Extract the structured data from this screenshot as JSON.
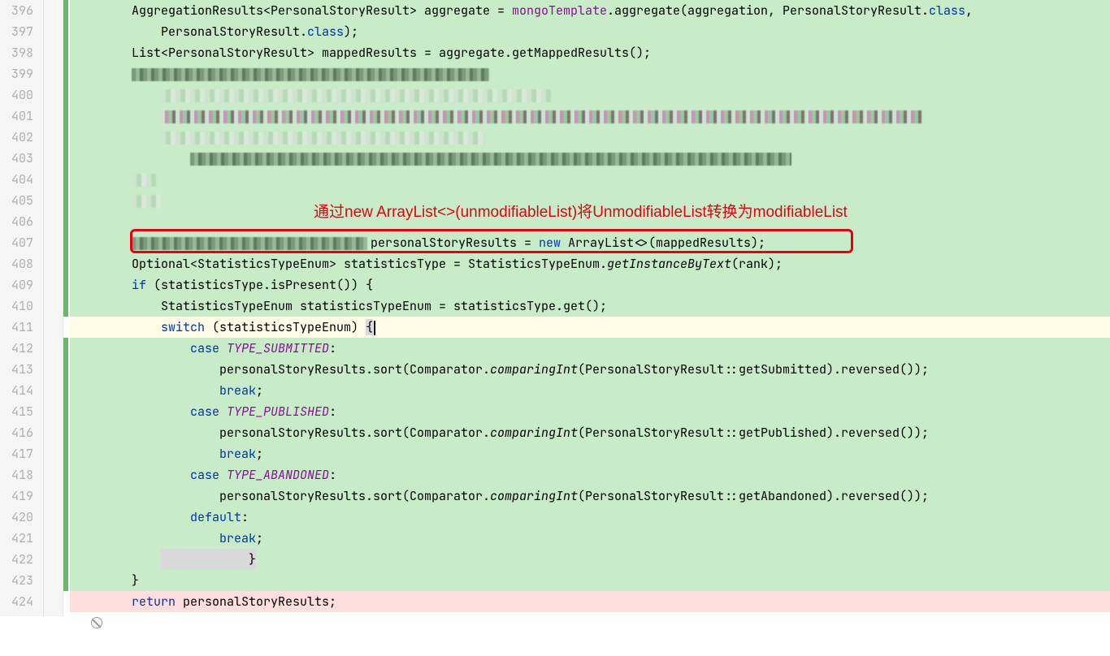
{
  "annotation": "通过new ArrayList<>(unmodifiableList)将UnmodifiableList转换为modifiableList",
  "lines": {
    "start": 396,
    "end": 424
  },
  "code": {
    "l396": {
      "pre": "        AggregationResults<PersonalStoryResult> aggregate = ",
      "mongo": "mongoTemplate",
      "post": ".aggregate(aggregation, PersonalStoryResult.",
      "clsref": "class",
      "tail": ","
    },
    "l397": {
      "pre": "            PersonalStoryResult.",
      "clsref": "class",
      "tail": ");"
    },
    "l398": "        List<PersonalStoryResult> mappedResults = aggregate.getMappedResults();",
    "l407": {
      "mid": "                personalStoryResults = ",
      "newkw": "new",
      "after": " ArrayList<>(mappedResults);"
    },
    "l408": {
      "pre": "        Optional<StatisticsTypeEnum> statisticsType = StatisticsTypeEnum.",
      "getinst": "getInstanceByText",
      "tail": "(rank);"
    },
    "l409": {
      "ifkw": "if",
      "rest": " (statisticsType.isPresent()) {"
    },
    "l410": "            StatisticsTypeEnum statisticsTypeEnum = statisticsType.get();",
    "l411": {
      "sw": "switch",
      "mid": " (statisticsTypeEnum) ",
      "brace": "{"
    },
    "l412": {
      "casekw": "case",
      "sp": " ",
      "enum": "TYPE_SUBMITTED",
      "tail": ":"
    },
    "l413": {
      "pre": "                    personalStoryResults.sort(Comparator.",
      "ci": "comparingInt",
      "mid": "(PersonalStoryResult::getSubmitted).reversed());"
    },
    "l414": {
      "br": "break",
      "tail": ";"
    },
    "l415": {
      "casekw": "case",
      "sp": " ",
      "enum": "TYPE_PUBLISHED",
      "tail": ":"
    },
    "l416": {
      "pre": "                    personalStoryResults.sort(Comparator.",
      "ci": "comparingInt",
      "mid": "(PersonalStoryResult::getPublished).reversed());"
    },
    "l417": {
      "br": "break",
      "tail": ";"
    },
    "l418": {
      "casekw": "case",
      "sp": " ",
      "enum": "TYPE_ABANDONED",
      "tail": ":"
    },
    "l419": {
      "pre": "                    personalStoryResults.sort(Comparator.",
      "ci": "comparingInt",
      "mid": "(PersonalStoryResult::getAbandoned).reversed());"
    },
    "l420": {
      "def": "default",
      "tail": ":"
    },
    "l421": {
      "br": "break",
      "tail": ";"
    },
    "l422": "            }",
    "l423": "        }",
    "l424": {
      "ret": "return",
      "rest": " personalStoryResults;"
    }
  }
}
